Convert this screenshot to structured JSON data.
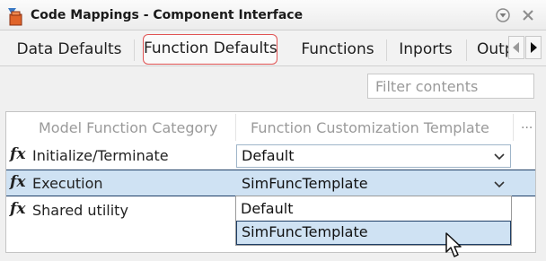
{
  "window": {
    "title": "Code Mappings - Component Interface",
    "icons": [
      "matlab-cube-icon",
      "options-circle-icon",
      "close-icon"
    ]
  },
  "tabs": [
    {
      "label": "Data Defaults",
      "active": false
    },
    {
      "label": "Function Defaults",
      "active": true
    },
    {
      "label": "Functions",
      "active": false
    },
    {
      "label": "Inports",
      "active": false
    },
    {
      "label": "Outports",
      "active": false
    }
  ],
  "filter": {
    "placeholder": "Filter contents",
    "value": ""
  },
  "table": {
    "columns": [
      "Model Function Category",
      "Function Customization Template"
    ],
    "more_columns_indicator": "...",
    "row_icon": "fx",
    "rows": [
      {
        "category": "Initialize/Terminate",
        "template": "Default",
        "selected": false
      },
      {
        "category": "Execution",
        "template": "SimFuncTemplate",
        "selected": true
      },
      {
        "category": "Shared utility",
        "template": "",
        "selected": false
      }
    ]
  },
  "dropdown": {
    "options": [
      "Default",
      "SimFuncTemplate"
    ],
    "highlighted": "SimFuncTemplate"
  },
  "colors": {
    "active_tab_border": "#e05353",
    "selection": "#cfe2f3",
    "selection_border": "#1f3f66"
  }
}
